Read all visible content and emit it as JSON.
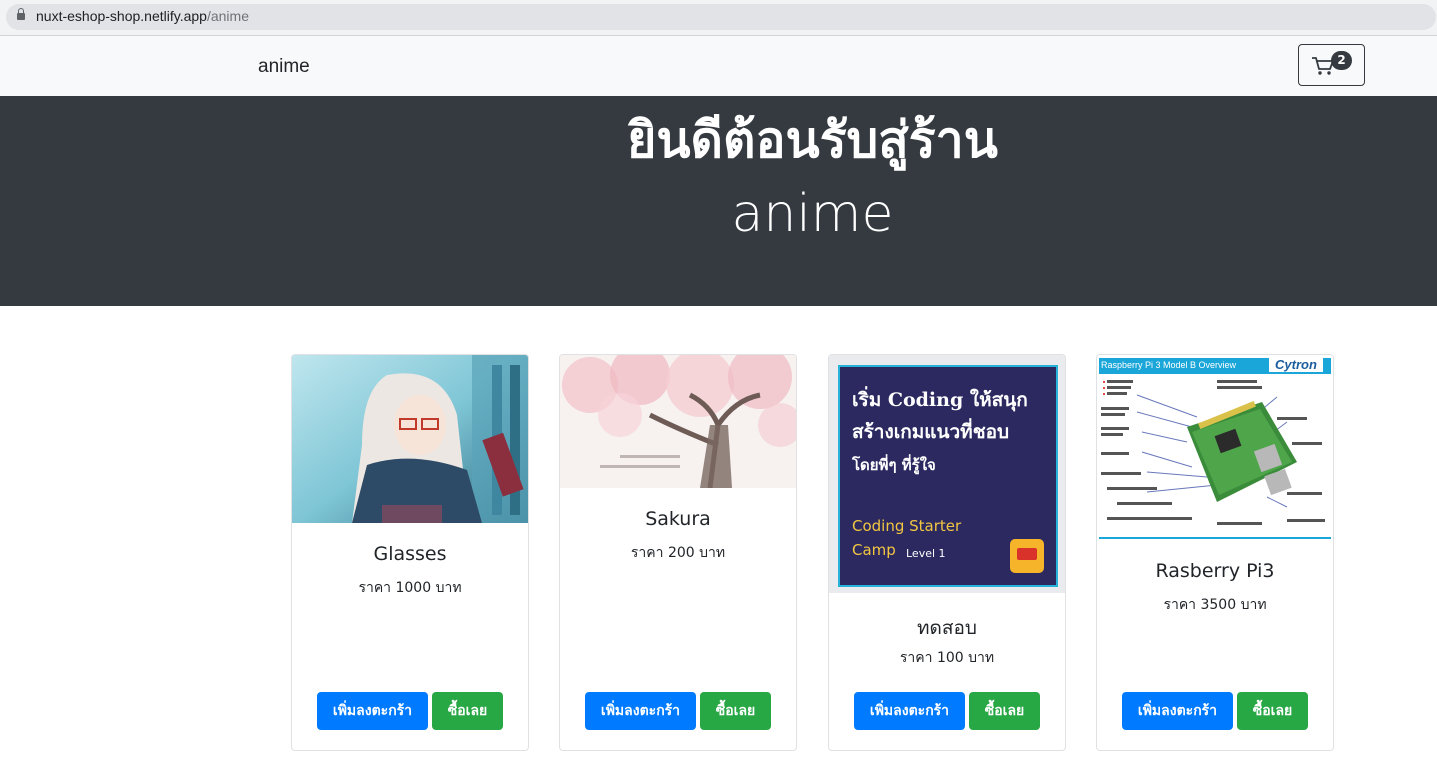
{
  "browser": {
    "url_host": "nuxt-eshop-shop.netlify.app",
    "url_path": "/anime"
  },
  "navbar": {
    "brand": "anime",
    "cart_count": "2"
  },
  "hero": {
    "title": "ยินดีต้อนรับสู่ร้าน",
    "subtitle": "anime"
  },
  "products": [
    {
      "name": "Glasses",
      "price": "ราคา 1000 บาท",
      "image_icon": "anime-girl-glasses-image",
      "add_label": "เพิ่มลงตะกร้า",
      "buy_label": "ซื้อเลย"
    },
    {
      "name": "Sakura",
      "price": "ราคา 200 บาท",
      "image_icon": "sakura-tree-image",
      "add_label": "เพิ่มลงตะกร้า",
      "buy_label": "ซื้อเลย"
    },
    {
      "name": "ทดสอบ",
      "price": "ราคา 100 บาท",
      "image_icon": "coding-camp-poster-image",
      "poster": {
        "line1": "เริ่ม Coding ให้สนุก",
        "line2": "สร้างเกมแนวที่ชอบ",
        "line3": "โดยพี่ๆ ที่รู้ใจ",
        "line4": "Coding Starter",
        "line5": "Camp",
        "level": "Level 1"
      },
      "add_label": "เพิ่มลงตะกร้า",
      "buy_label": "ซื้อเลย"
    },
    {
      "name": "Rasberry Pi3",
      "price": "ราคา 3500 บาท",
      "image_icon": "raspberry-pi-diagram-image",
      "diagram_title": "Raspberry Pi 3 Model B Overview",
      "diagram_brand": "Cytron",
      "add_label": "เพิ่มลงตะกร้า",
      "buy_label": "ซื้อเลย"
    }
  ],
  "colors": {
    "primary": "#007bff",
    "success": "#28a745",
    "dark": "#343a40"
  }
}
